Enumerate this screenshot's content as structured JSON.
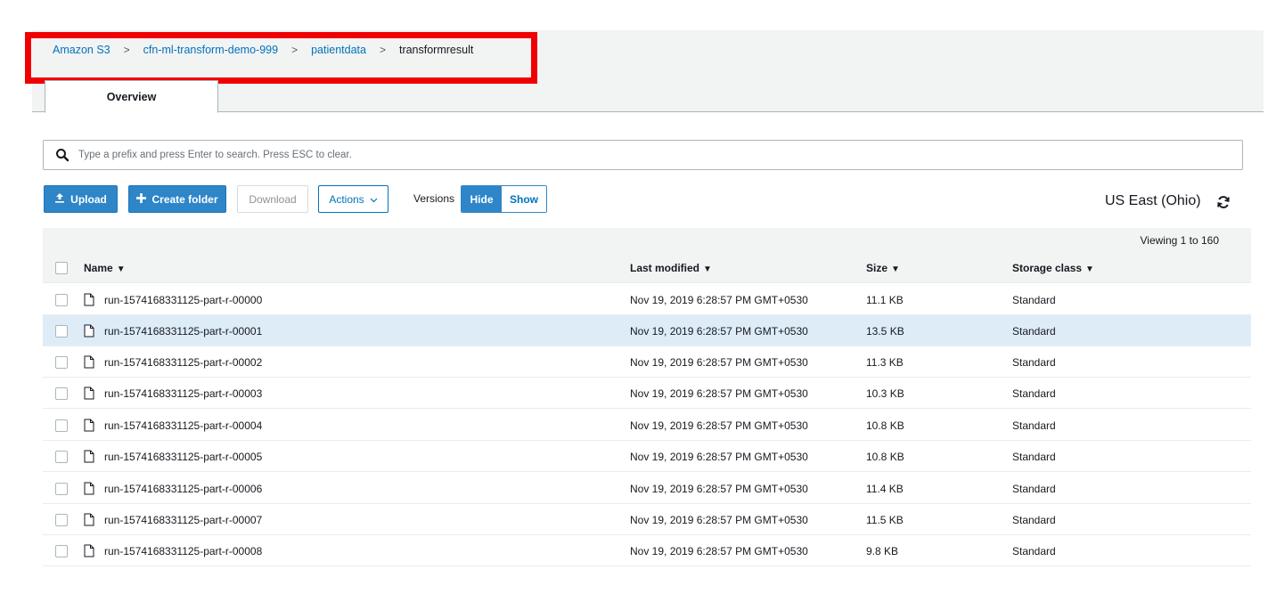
{
  "breadcrumb": {
    "items": [
      "Amazon S3",
      "cfn-ml-transform-demo-999",
      "patientdata"
    ],
    "current": "transformresult",
    "separator": ">"
  },
  "tabs": {
    "overview": "Overview"
  },
  "search": {
    "placeholder": "Type a prefix and press Enter to search. Press ESC to clear."
  },
  "toolbar": {
    "upload": "Upload",
    "create_folder": "Create folder",
    "download": "Download",
    "actions": "Actions",
    "versions_label": "Versions",
    "hide": "Hide",
    "show": "Show"
  },
  "region": "US East (Ohio)",
  "viewing": "Viewing 1 to 160",
  "columns": {
    "name": "Name",
    "last_modified": "Last modified",
    "size": "Size",
    "storage_class": "Storage class"
  },
  "rows": [
    {
      "name": "run-1574168331125-part-r-00000",
      "modified": "Nov 19, 2019 6:28:57 PM GMT+0530",
      "size": "11.1 KB",
      "class": "Standard"
    },
    {
      "name": "run-1574168331125-part-r-00001",
      "modified": "Nov 19, 2019 6:28:57 PM GMT+0530",
      "size": "13.5 KB",
      "class": "Standard"
    },
    {
      "name": "run-1574168331125-part-r-00002",
      "modified": "Nov 19, 2019 6:28:57 PM GMT+0530",
      "size": "11.3 KB",
      "class": "Standard"
    },
    {
      "name": "run-1574168331125-part-r-00003",
      "modified": "Nov 19, 2019 6:28:57 PM GMT+0530",
      "size": "10.3 KB",
      "class": "Standard"
    },
    {
      "name": "run-1574168331125-part-r-00004",
      "modified": "Nov 19, 2019 6:28:57 PM GMT+0530",
      "size": "10.8 KB",
      "class": "Standard"
    },
    {
      "name": "run-1574168331125-part-r-00005",
      "modified": "Nov 19, 2019 6:28:57 PM GMT+0530",
      "size": "10.8 KB",
      "class": "Standard"
    },
    {
      "name": "run-1574168331125-part-r-00006",
      "modified": "Nov 19, 2019 6:28:57 PM GMT+0530",
      "size": "11.4 KB",
      "class": "Standard"
    },
    {
      "name": "run-1574168331125-part-r-00007",
      "modified": "Nov 19, 2019 6:28:57 PM GMT+0530",
      "size": "11.5 KB",
      "class": "Standard"
    },
    {
      "name": "run-1574168331125-part-r-00008",
      "modified": "Nov 19, 2019 6:28:57 PM GMT+0530",
      "size": "9.8 KB",
      "class": "Standard"
    }
  ],
  "colors": {
    "accent": "#0073bb",
    "primary_button": "#2e86c9",
    "highlight_box": "#f00000",
    "selected_row": "#ddecf7"
  }
}
